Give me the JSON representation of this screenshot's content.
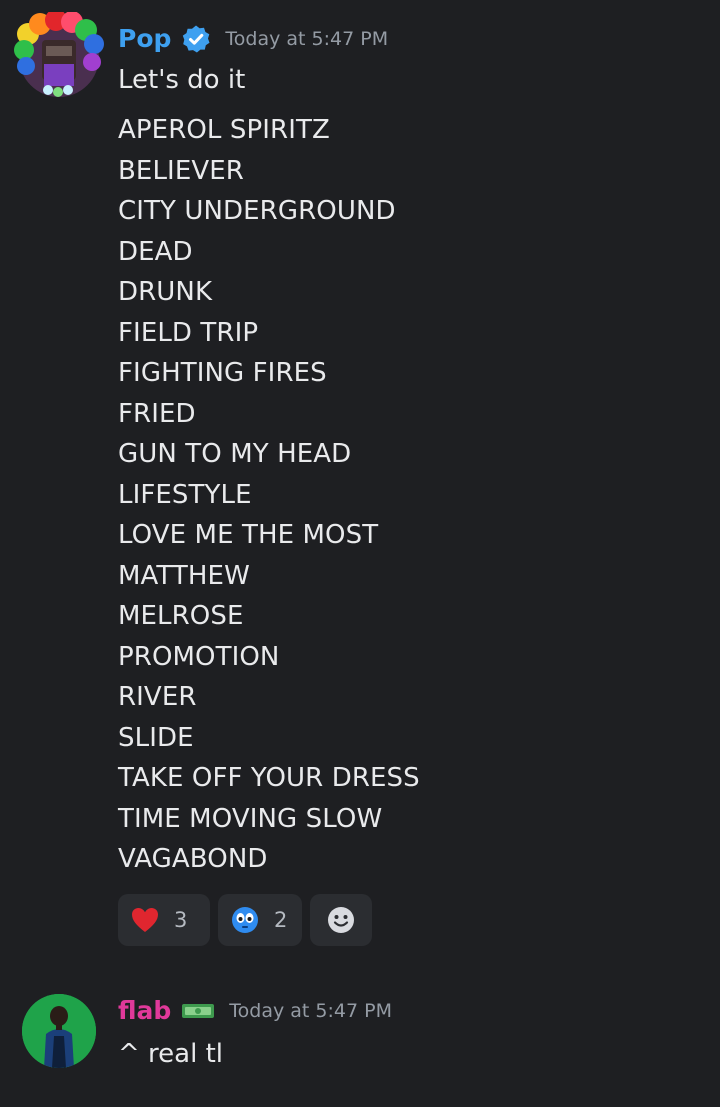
{
  "messages": [
    {
      "username": "Pop",
      "username_color": "#3ea0f0",
      "badge": "verified-icon",
      "timestamp": "Today at 5:47 PM",
      "text": "Let's do it",
      "songs": [
        "APEROL SPIRITZ",
        "BELIEVER",
        "CITY UNDERGROUND",
        "DEAD",
        "DRUNK",
        "FIELD TRIP",
        "FIGHTING FIRES",
        "FRIED",
        "GUN TO MY HEAD",
        "LIFESTYLE",
        "LOVE ME THE MOST",
        "MATTHEW",
        "MELROSE",
        "PROMOTION",
        "RIVER",
        "SLIDE",
        "TAKE OFF YOUR DRESS",
        "TIME MOVING SLOW",
        "VAGABOND"
      ],
      "reactions": [
        {
          "emoji": "red-heart-icon",
          "count": "3"
        },
        {
          "emoji": "flushed-face-icon",
          "count": "2"
        },
        {
          "emoji": "add-reaction-icon",
          "count": ""
        }
      ]
    },
    {
      "username": "flab",
      "username_color": "#e0399a",
      "badge": "money-tag-icon",
      "timestamp": "Today at 5:47 PM",
      "text": "^ real tl"
    }
  ],
  "colors": {
    "background": "#1e1f22",
    "reaction_bg": "#2b2d31",
    "timestamp": "#949ba4",
    "text": "#e9eaec"
  }
}
